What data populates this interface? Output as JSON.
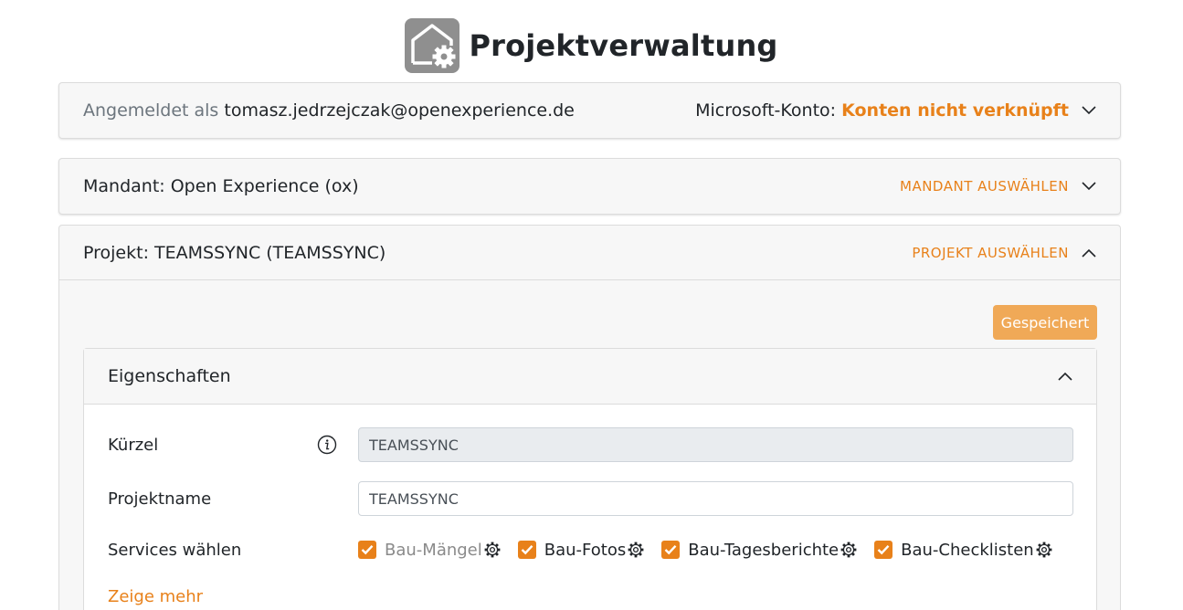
{
  "app": {
    "title": "Projektverwaltung",
    "logo_icon": "house-gear-icon"
  },
  "account": {
    "logged_in_prefix": "Angemeldet als",
    "email": "tomasz.jedrzejczak@openexperience.de",
    "ms_label": "Microsoft-Konto:",
    "ms_status": "Konten nicht verknüpft"
  },
  "mandant": {
    "label": "Mandant: Open Experience (ox)",
    "action": "MANDANT AUSWÄHLEN"
  },
  "projekt": {
    "label": "Projekt: TEAMSSYNC (TEAMSSYNC)",
    "action": "PROJEKT AUSWÄHLEN",
    "saved_button": "Gespeichert"
  },
  "properties": {
    "title": "Eigenschaften",
    "kuerzel_label": "Kürzel",
    "kuerzel_value": "TEAMSSYNC",
    "name_label": "Projektname",
    "name_value": "TEAMSSYNC",
    "services_label": "Services wählen",
    "services": [
      {
        "label": "Bau-Mängel",
        "checked": true,
        "dimmed": true
      },
      {
        "label": "Bau-Fotos",
        "checked": true,
        "dimmed": false
      },
      {
        "label": "Bau-Tagesberichte",
        "checked": true,
        "dimmed": false
      },
      {
        "label": "Bau-Checklisten",
        "checked": true,
        "dimmed": false
      }
    ],
    "show_more": "Zeige mehr"
  },
  "colors": {
    "accent": "#e8811a",
    "saved_button_bg": "#f0a957",
    "card_bg": "#f7f7f7",
    "logo_bg": "#8f8f8f"
  }
}
